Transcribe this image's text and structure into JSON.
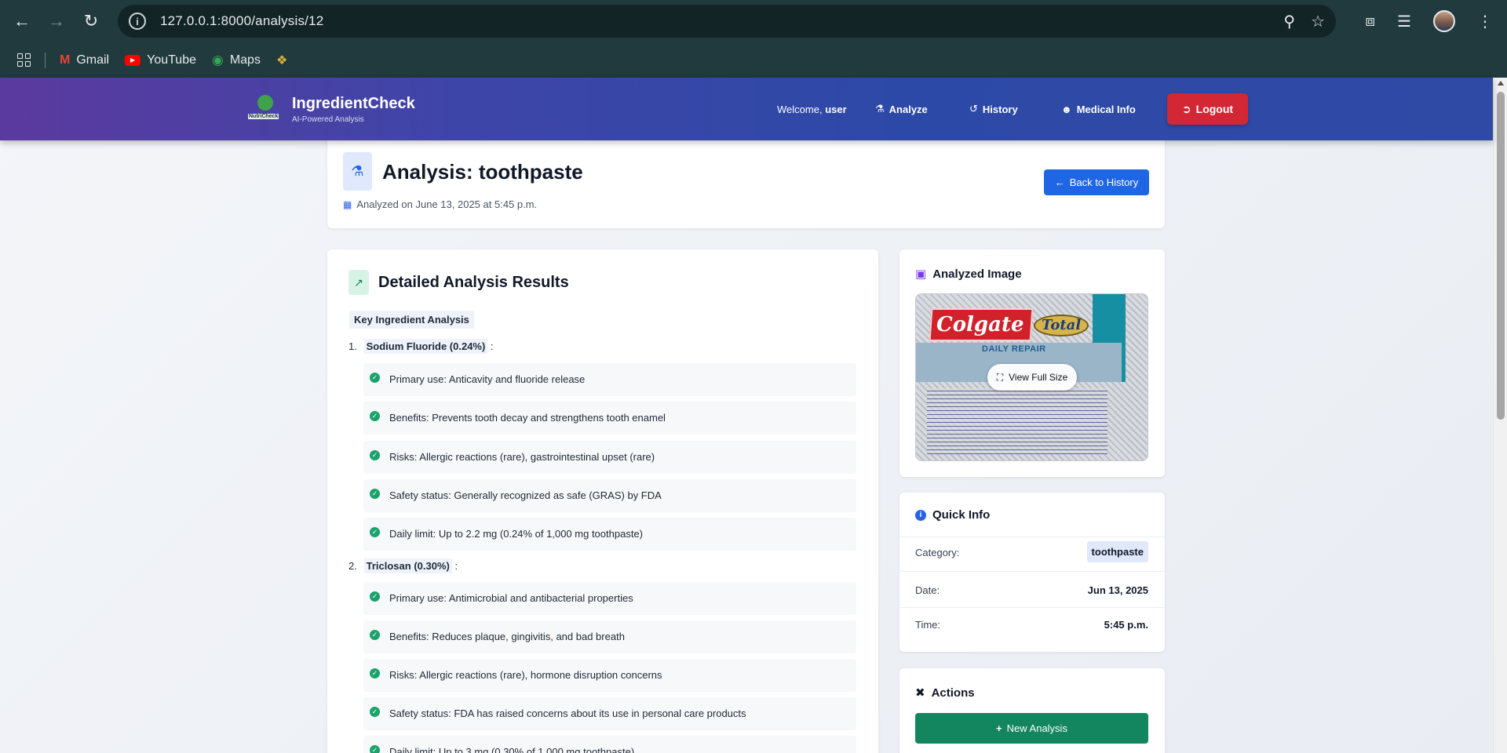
{
  "browser": {
    "url": "127.0.0.1:8000/analysis/12",
    "bookmarks": [
      {
        "label": "Gmail",
        "icon": "gmail-icon"
      },
      {
        "label": "YouTube",
        "icon": "youtube-icon"
      },
      {
        "label": "Maps",
        "icon": "maps-icon"
      }
    ]
  },
  "header": {
    "brand_title": "IngredientCheck",
    "brand_subtitle": "AI-Powered Analysis",
    "logo_text": "NutriCheck",
    "welcome_prefix": "Welcome,",
    "welcome_user": "user",
    "nav": {
      "analyze": "Analyze",
      "history": "History",
      "medical": "Medical Info"
    },
    "logout": "Logout",
    "logout_color": "#d32735"
  },
  "title_card": {
    "title": "Analysis: toothpaste",
    "analyzed_on": "Analyzed on June 13, 2025 at 5:45 p.m.",
    "back_button": "Back to History"
  },
  "results": {
    "heading": "Detailed Analysis Results",
    "key_label": "Key Ingredient Analysis",
    "ingredients": [
      {
        "number": "1.",
        "name": "Sodium Fluoride (0.24%)",
        "suffix": " :",
        "points": [
          "Primary use: Anticavity and fluoride release",
          "Benefits: Prevents tooth decay and strengthens tooth enamel",
          "Risks: Allergic reactions (rare), gastrointestinal upset (rare)",
          "Safety status: Generally recognized as safe (GRAS) by FDA",
          "Daily limit: Up to 2.2 mg (0.24% of 1,000 mg toothpaste)"
        ]
      },
      {
        "number": "2.",
        "name": "Triclosan (0.30%)",
        "suffix": " :",
        "points": [
          "Primary use: Antimicrobial and antibacterial properties",
          "Benefits: Reduces plaque, gingivitis, and bad breath",
          "Risks: Allergic reactions (rare), hormone disruption concerns",
          "Safety status: FDA has raised concerns about its use in personal care products",
          "Daily limit: Up to 3 mg (0.30% of 1,000 mg toothpaste)"
        ]
      }
    ]
  },
  "image_card": {
    "heading": "Analyzed Image",
    "view_full": "View Full Size",
    "package_brand": "Colgate",
    "package_sub": "Total",
    "package_line": "DAILY REPAIR"
  },
  "quick_info": {
    "heading": "Quick Info",
    "category_label": "Category:",
    "category_value": "toothpaste",
    "date_label": "Date:",
    "date_value": "Jun 13, 2025",
    "time_label": "Time:",
    "time_value": "5:45 p.m."
  },
  "actions": {
    "heading": "Actions",
    "new_analysis": "New Analysis"
  }
}
